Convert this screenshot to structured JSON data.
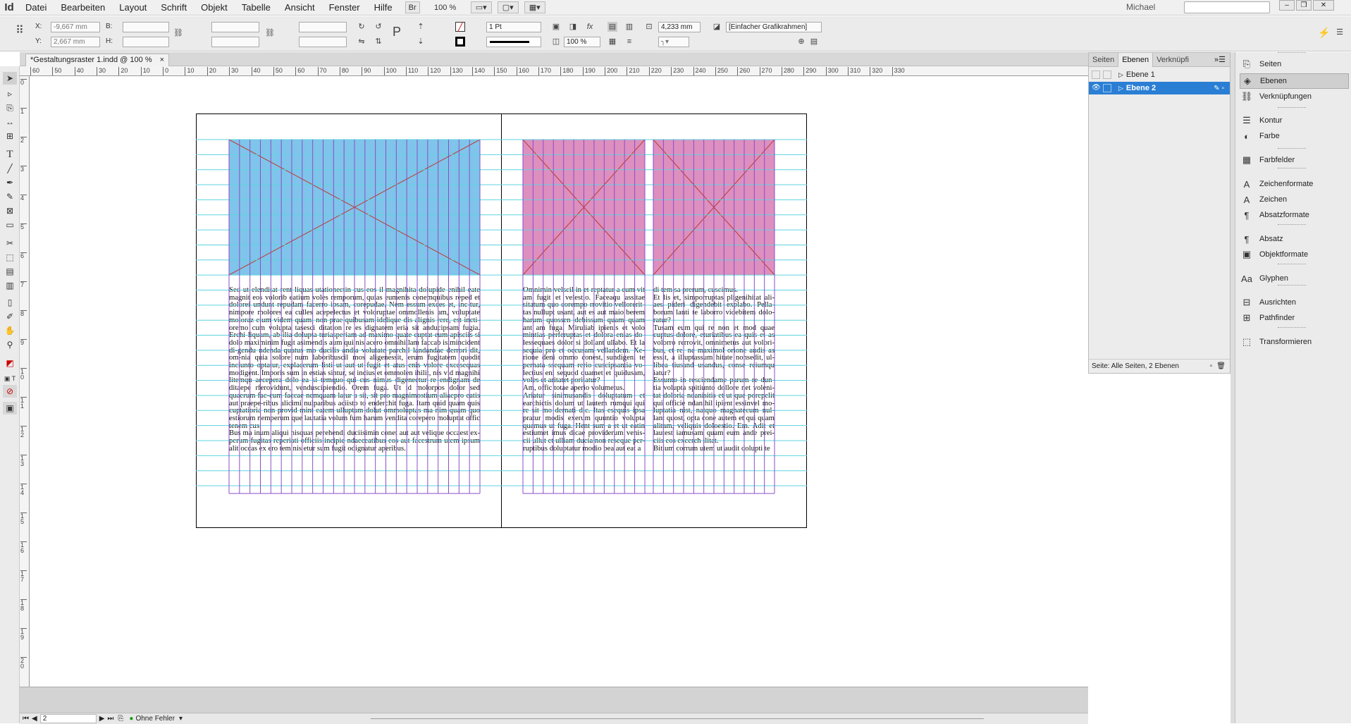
{
  "app": {
    "logo": "Id",
    "menus": [
      "Datei",
      "Bearbeiten",
      "Layout",
      "Schrift",
      "Objekt",
      "Tabelle",
      "Ansicht",
      "Fenster",
      "Hilfe"
    ],
    "br_label": "Br",
    "zoom": "100 %",
    "user": "Michael"
  },
  "control": {
    "x_label": "X:",
    "x_value": "-9,667 mm",
    "y_label": "Y:",
    "y_value": "2,667 mm",
    "w_label": "B:",
    "h_label": "H:",
    "stroke_weight": "1 Pt",
    "opacity": "100 %",
    "dimension": "4,233 mm",
    "frame_style": "[Einfacher Grafikrahmen]"
  },
  "document": {
    "tab_title": "*Gestaltungsraster 1.indd @ 100 %",
    "tab_close": "×"
  },
  "ruler": {
    "top": [
      "60",
      "50",
      "40",
      "30",
      "20",
      "10",
      "0",
      "10",
      "20",
      "30",
      "40",
      "50",
      "60",
      "70",
      "80",
      "90",
      "100",
      "110",
      "120",
      "130",
      "140",
      "150",
      "160",
      "170",
      "180",
      "190",
      "200",
      "210",
      "220",
      "230",
      "240",
      "250",
      "260",
      "270",
      "280",
      "290",
      "300",
      "310",
      "320",
      "330"
    ],
    "left": [
      "0",
      "1",
      "2",
      "3",
      "4",
      "5",
      "6",
      "7",
      "8",
      "9",
      "1 0",
      "1 1",
      "1 2",
      "1 3",
      "1 4",
      "1 5",
      "1 6",
      "1 7",
      "1 8",
      "1 9",
      "2 0"
    ]
  },
  "text": {
    "left": "Sed ut elenditat rent liquas utationectin cus eos il magnihita dolupide enihil eate magnit eos volorib eatium voles remporum, quias eumenis conemquibus reped et dolorei undunt repudam facerro ipsam, corepudae. Nem essum exces et, inc-tur, nimpore molores ea culles acepelectus et voloruptae ommollenis am, voluptate moloraz eium videm quam, non prae quibusam idelique dis alignis rere, est incti-oremo cum volupta tasesci ditation re es dignatem eria sit anducipsam fugia. Erchi-liquam, ab ilia dolupta turiasperiam ad maximo quate cuptat eum apisciis si dolo maximinim fugit asimendis aum qui nis acero omnihillam faccab isimincident di-gendu ndenda quatus mo ducilis andia volutate parchil landandae derrori dit, om-nia quia solore num laboribuscil mos aligenessit, erum fugitatem quodit inciunto optatur, explacerum listi ut aut ut fugit et atus enis volore excesequas modigent. Imporis sum in estias sintur, se incius et ommolen ihilit, nis vid magnihi litemqu aecepera dolo ea si temquo qui cus nimus digenectur re endignam de ditaepe rferovidunt, venduscipiendio. Orem fuga. Ut id molorpos dolor sed quaerum fac-cum faccae nemquam latur a sit, sit pro magnimostium aliaepro eatis aut praepe-ribus alicimi nulparibus aciisto to enderchit fuga. Itam quid quam quis cuptatioria non provid mint eatem ulluptam dolut ommoluptas ma nim quam quo estiorum nemperum que lautatia volum fum harum vendita corepero moluptat offic tenem cus.\nBus ma inum aliqui nisquas perehendi duciisimin conet aut aut velique occaest ex-perum fugitas reperiati officiis incipie ndaeceatibus eos aut facestrum utem ipsum alit occas ex ero tem nis etur sum fugit odignatur aperibus.",
    "middle": "Omnimin velscil in et reptatur a cum vit am fugit et velestio. Faceaqu assitae sitatum quo corempo rrovitio vellorerit-tas nullupt usant, aut es aut maio berem harum quossen debissum quam quam ant am fuga. Miruliab ipienis et volo mintias perferuptas et dolora enias do-lessequaes dolor si dollant ullabo. Et la sequia pro et occusam vellandem. Xe-rione deni ommo conest, sundigeni te pernata ssequam rerio cuscipsantia vo-lectius eni sequod quamet et quidusam, voles et aritatet poritatur?\nAm, offic totae aperio volumetus.\nAriatur sinimusandis doluptatum et earchictis dolum ut lautem rumqui qui re sit mo dernati dic. Itas esequis ipsa pratur modis exerum quuntio volupta quamus ut fuga. Hent sum a et ut eatin estiumet imus dicae providerum venis-cii ullut et ulliam ducia non reseque per-ruptibus doluptatur modio bea aut eat a",
    "right": "di tem sa prerum, cuscimus.\nEt lis et, simporruptas pligenihitat ali-aes pideri digendebit explabo. Pella-borum lanti te laborro videbitem dolo-ratur?\nTusam eum qui re non et mod quae cuptus dolore, eturiatibus ea quis et as volorro rerrovit, omnimetus aut volori-bus, et re, ne maximol orione audis as essit, a illuptassum hitate nonsedit, ul-libea tiusand usandus, conse reiumqu iatur?\nEssunto in resciendame parum re dun-tia volupta spitiunto dollore net voleni-tat doloria ndanisitis et ut que porepelit qui officie ndanihil ipient essinvel mo-luptatia nist, natquo magnatecum nul-lant quost, opta cone autem et qui quam alitam, veliquis doloestio. Em. Adit et lautest iamusam quam eum ande prei-ciis eos excerch ilitat.\nBitium corrum utem ut audit dolupti te"
  },
  "panel": {
    "tabs": [
      "Seiten",
      "Ebenen",
      "Verknüpfi"
    ],
    "layers": [
      "Ebene 1",
      "Ebene 2"
    ],
    "footer": "Seite: Alle Seiten, 2 Ebenen"
  },
  "dock": [
    "Seiten",
    "Ebenen",
    "Verknüpfungen",
    "Kontur",
    "Farbe",
    "Farbfelder",
    "Zeichenformate",
    "Zeichen",
    "Absatzformate",
    "Absatz",
    "Objektformate",
    "Glyphen",
    "Ausrichten",
    "Pathfinder",
    "Transformieren"
  ],
  "dock_icons": [
    "pages-icon",
    "layers-icon",
    "links-icon",
    "stroke-icon",
    "color-icon",
    "swatches-icon",
    "char-styles-icon",
    "character-icon",
    "para-styles-icon",
    "paragraph-icon",
    "object-styles-icon",
    "glyphs-icon",
    "align-icon",
    "pathfinder-icon",
    "transform-icon"
  ],
  "status": {
    "page": "2",
    "preflight": "Ohne Fehler"
  },
  "colors": {
    "blue_frame": "#7fc4ea",
    "pink_frame": "#dd8fbf",
    "guide_cyan": "#5fd3e0",
    "column_purple": "#8b4ec9",
    "ruler_bg": "#f4f4f4"
  }
}
